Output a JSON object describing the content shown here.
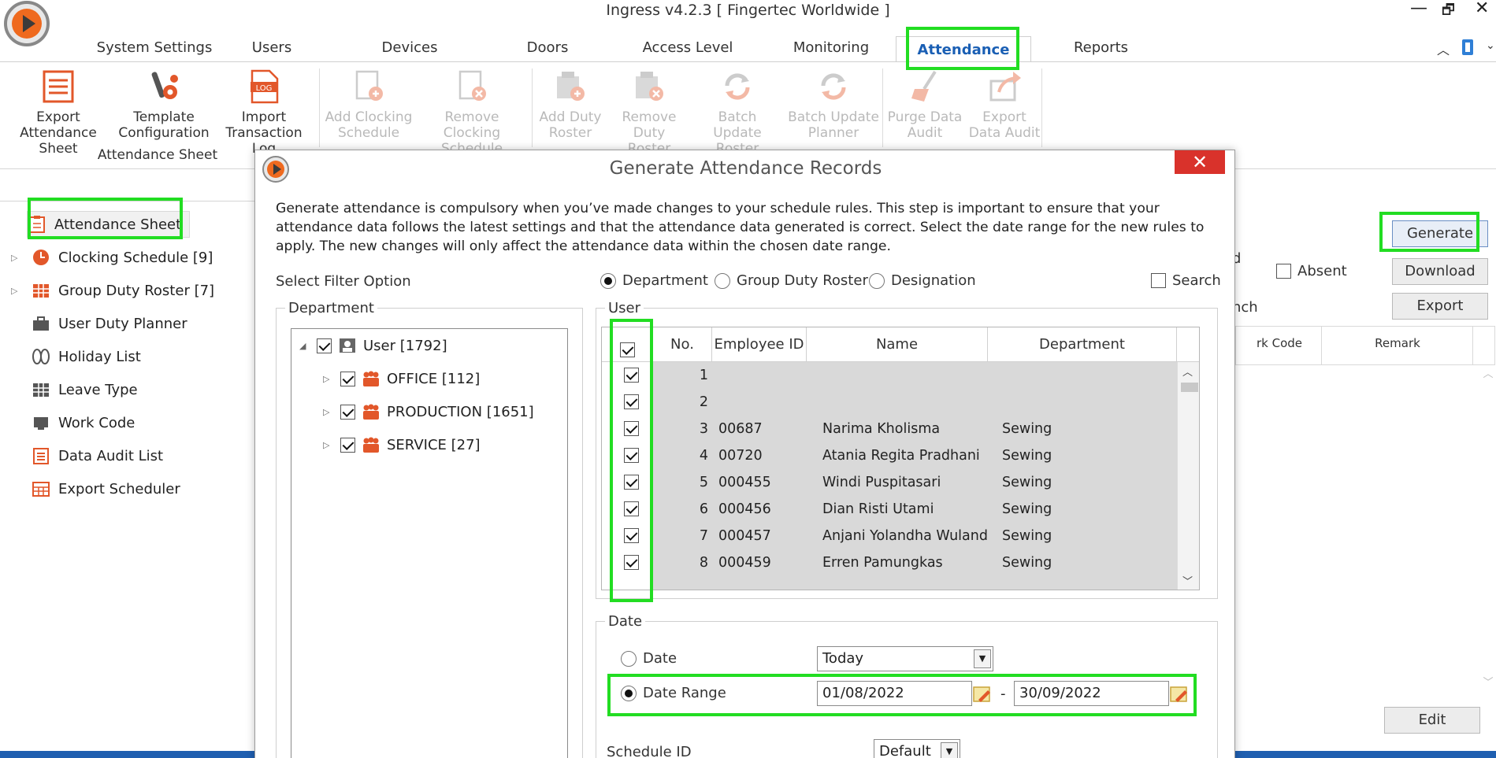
{
  "window": {
    "title": "Ingress v4.2.3 [ Fingertec Worldwide ]",
    "controls": [
      "—",
      "🗗",
      "✕"
    ]
  },
  "tabs": [
    {
      "label": "System Settings"
    },
    {
      "label": "Users"
    },
    {
      "label": "Devices"
    },
    {
      "label": "Doors"
    },
    {
      "label": "Access Level"
    },
    {
      "label": "Monitoring"
    },
    {
      "label": "Attendance"
    },
    {
      "label": "Reports"
    }
  ],
  "ribbon": {
    "buttons": [
      {
        "line1": "Export",
        "line2": "Attendance Sheet"
      },
      {
        "line1": "Template",
        "line2": "Configuration"
      },
      {
        "line1": "Import",
        "line2": "Transaction Log"
      },
      {
        "line1": "Add Clocking",
        "line2": "Schedule"
      },
      {
        "line1": "Remove Clocking",
        "line2": "Schedule"
      },
      {
        "line1": "Add Duty",
        "line2": "Roster"
      },
      {
        "line1": "Remove Duty",
        "line2": "Roster"
      },
      {
        "line1": "Batch Update",
        "line2": "Roster"
      },
      {
        "line1": "Batch Update",
        "line2": "Planner"
      },
      {
        "line1": "Purge Data",
        "line2": "Audit"
      },
      {
        "line1": "Export",
        "line2": "Data Audit"
      }
    ],
    "group_label": "Attendance Sheet",
    "log_text": "LOG"
  },
  "nav": {
    "items": [
      {
        "label": "Attendance Sheet"
      },
      {
        "label": "Clocking Schedule [9]"
      },
      {
        "label": "Group Duty Roster [7]"
      },
      {
        "label": "User Duty Planner"
      },
      {
        "label": "Holiday List"
      },
      {
        "label": "Leave Type"
      },
      {
        "label": "Work Code"
      },
      {
        "label": "Data Audit List"
      },
      {
        "label": "Export Scheduler"
      }
    ]
  },
  "background_panel": {
    "generate": "Generate",
    "download": "Download",
    "export": "Export",
    "edit": "Edit",
    "absent_label": "Absent",
    "frag_d": "d",
    "frag_nch": "nch",
    "col_work_code": "rk Code",
    "col_remark": "Remark"
  },
  "dialog": {
    "title": "Generate Attendance Records",
    "close": "✕",
    "description": "Generate attendance is compulsory when you’ve made changes to your schedule rules. This step is important to ensure that your attendance data follows the latest settings and that the attendance data generated is correct. Select the date range for the new rules to apply. The new changes will only affect the attendance data within the chosen date range.",
    "filter_label": "Select Filter Option",
    "filter_options": [
      {
        "label": "Department",
        "selected": true
      },
      {
        "label": "Group Duty Roster",
        "selected": false
      },
      {
        "label": "Designation",
        "selected": false
      }
    ],
    "search_label": "Search",
    "department_legend": "Department",
    "tree": [
      {
        "label": "User [1792]"
      },
      {
        "label": "OFFICE [112]"
      },
      {
        "label": "PRODUCTION [1651]"
      },
      {
        "label": "SERVICE [27]"
      }
    ],
    "user_legend": "User",
    "user_columns": [
      "No.",
      "Employee ID",
      "Name",
      "Department"
    ],
    "users": [
      {
        "no": "1",
        "id": "",
        "name": "",
        "dept": ""
      },
      {
        "no": "2",
        "id": "",
        "name": "",
        "dept": ""
      },
      {
        "no": "3",
        "id": "00687",
        "name": "Narima Kholisma",
        "dept": "Sewing"
      },
      {
        "no": "4",
        "id": "00720",
        "name": "Atania Regita Pradhani",
        "dept": "Sewing"
      },
      {
        "no": "5",
        "id": "000455",
        "name": "Windi Puspitasari",
        "dept": "Sewing"
      },
      {
        "no": "6",
        "id": "000456",
        "name": "Dian Risti Utami",
        "dept": "Sewing"
      },
      {
        "no": "7",
        "id": "000457",
        "name": "Anjani Yolandha Wulandari",
        "dept": "Sewing"
      },
      {
        "no": "8",
        "id": "000459",
        "name": "Erren Pamungkas",
        "dept": "Sewing"
      }
    ],
    "date_legend": "Date",
    "date_option": "Date",
    "date_combo": "Today",
    "date_range_option": "Date Range",
    "date_from": "01/08/2022",
    "date_sep": "-",
    "date_to": "30/09/2022",
    "schedule_label": "Schedule ID",
    "schedule_value": "Default"
  },
  "colors": {
    "accent_blue": "#1a5fb4",
    "highlight_green": "#22dd22",
    "close_red": "#d9322b",
    "status_strip": "#1f5fb0"
  }
}
